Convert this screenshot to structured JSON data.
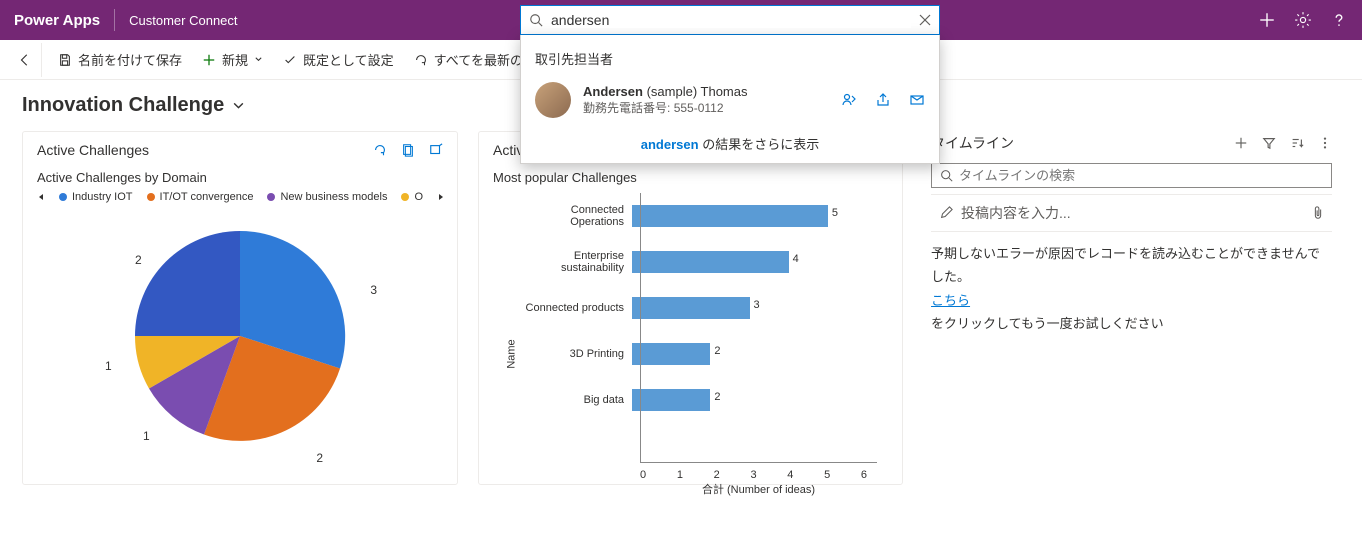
{
  "header": {
    "app_title": "Power Apps",
    "app_sub": "Customer Connect"
  },
  "search": {
    "value": "andersen",
    "placeholder": "",
    "section_label": "取引先担当者",
    "result": {
      "name_bold": "Andersen",
      "name_rest": "(sample) Thomas",
      "phone_label": "勤務先電話番号:",
      "phone": "555-0112"
    },
    "more_bold": "andersen",
    "more_rest": "の結果をさらに表示"
  },
  "commands": {
    "save_as": "名前を付けて保存",
    "new": "新規",
    "set_default": "既定として設定",
    "refresh_all": "すべてを最新の"
  },
  "page": {
    "title": "Innovation Challenge"
  },
  "pie_card": {
    "title": "Active Challenges",
    "subtitle": "Active Challenges by Domain"
  },
  "bar_card": {
    "title": "Active Challenges",
    "subtitle": "Most popular Challenges"
  },
  "chart_data": [
    {
      "type": "pie",
      "title": "Active Challenges by Domain",
      "series": [
        {
          "name": "Industry IOT",
          "value": 3,
          "color": "#2f7bd8"
        },
        {
          "name": "IT/OT convergence",
          "value": 2,
          "color": "#e36f1e"
        },
        {
          "name": "New business models",
          "value": 1,
          "color": "#7a4db0"
        },
        {
          "name": "O",
          "value": 1,
          "color": "#f0b427"
        },
        {
          "name": "(next)",
          "value": 2,
          "color": "#3358c2"
        }
      ],
      "legend_position": "top"
    },
    {
      "type": "bar",
      "orientation": "horizontal",
      "title": "Most popular Challenges",
      "xlabel": "合計 (Number of ideas)",
      "ylabel": "Name",
      "xlim": [
        0,
        6
      ],
      "xticks": [
        0,
        1,
        2,
        3,
        4,
        5,
        6
      ],
      "categories": [
        "Connected Operations",
        "Enterprise sustainability",
        "Connected products",
        "3D Printing",
        "Big data"
      ],
      "values": [
        5,
        4,
        3,
        2,
        2
      ]
    }
  ],
  "timeline": {
    "title": "タイムライン",
    "search_placeholder": "タイムラインの検索",
    "post_placeholder": "投稿内容を入力...",
    "error_line1": "予期しないエラーが原因でレコードを読み込むことができませんでした。",
    "error_link": "こちら",
    "error_line2": "をクリックしてもう一度お試しください"
  }
}
